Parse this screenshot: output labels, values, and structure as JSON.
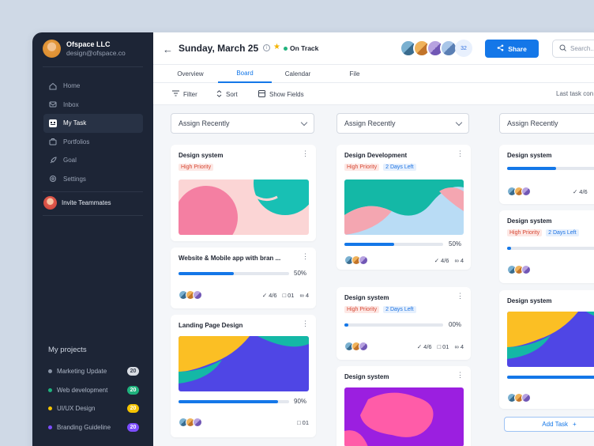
{
  "sidebar": {
    "workspace": {
      "name": "Ofspace LLC",
      "email": "design@ofspace.co"
    },
    "nav": [
      {
        "label": "Home",
        "icon": "home-icon"
      },
      {
        "label": "Inbox",
        "icon": "inbox-icon"
      },
      {
        "label": "My Task",
        "icon": "task-icon",
        "active": true
      },
      {
        "label": "Portfolios",
        "icon": "portfolio-icon"
      },
      {
        "label": "Goal",
        "icon": "rocket-icon"
      },
      {
        "label": "Settings",
        "icon": "gear-icon"
      }
    ],
    "invite_label": "Invite Teammates",
    "projects_title": "My projects",
    "projects": [
      {
        "name": "Marketing Update",
        "count": "20",
        "color": "#8a94a6",
        "badge_bg": "#d9dde4",
        "badge_fg": "#3b4352"
      },
      {
        "name": "Web development",
        "count": "20",
        "color": "#1fb27d",
        "badge_bg": "#1fb27d",
        "badge_fg": "#ffffff"
      },
      {
        "name": "UI/UX Design",
        "count": "20",
        "color": "#f4c300",
        "badge_bg": "#f4c300",
        "badge_fg": "#ffffff"
      },
      {
        "name": "Branding Guideline",
        "count": "20",
        "color": "#7c4dff",
        "badge_bg": "#7c4dff",
        "badge_fg": "#ffffff"
      }
    ]
  },
  "header": {
    "date": "Sunday, March 25",
    "status": "On Track",
    "member_more": "32",
    "share_label": "Share",
    "search_placeholder": "Search..."
  },
  "tabs": [
    "Overview",
    "Board",
    "Calendar",
    "File"
  ],
  "active_tab": "Board",
  "toolbar": {
    "filter": "Filter",
    "sort": "Sort",
    "fields": "Show Fields",
    "last_task": "Last task con"
  },
  "columns": [
    {
      "dropdown": "Assign Recently",
      "cards": [
        {
          "title": "Design system",
          "tags": [
            "High Priority"
          ]
        },
        {
          "title": "Website & Mobile app with bran ...",
          "progress": "50%",
          "checks": "4/6",
          "comments": "01",
          "links": "4"
        },
        {
          "title": "Landing Page Design",
          "progress": "90%",
          "comments": "01"
        }
      ]
    },
    {
      "dropdown": "Assign Recently",
      "cards": [
        {
          "title": "Design Development",
          "tags": [
            "High Priority",
            "2 Days Left"
          ],
          "progress": "50%",
          "checks": "4/6",
          "links": "4"
        },
        {
          "title": "Design system",
          "tags": [
            "High Priority",
            "2 Days Left"
          ],
          "progress": "00%",
          "checks": "4/6",
          "comments": "01",
          "links": "4"
        },
        {
          "title": "Design system"
        }
      ]
    },
    {
      "dropdown": "Assign Recently",
      "cards": [
        {
          "title": "Design system",
          "checks": "4/6"
        },
        {
          "title": "Design system",
          "tags": [
            "High Priority",
            "2 Days Left"
          ]
        },
        {
          "title": "Design system"
        }
      ],
      "add_task": "Add Task"
    }
  ],
  "colors": {
    "accent": "#1477e8",
    "sidebar": "#1d2536",
    "on_track": "#21b27d"
  }
}
